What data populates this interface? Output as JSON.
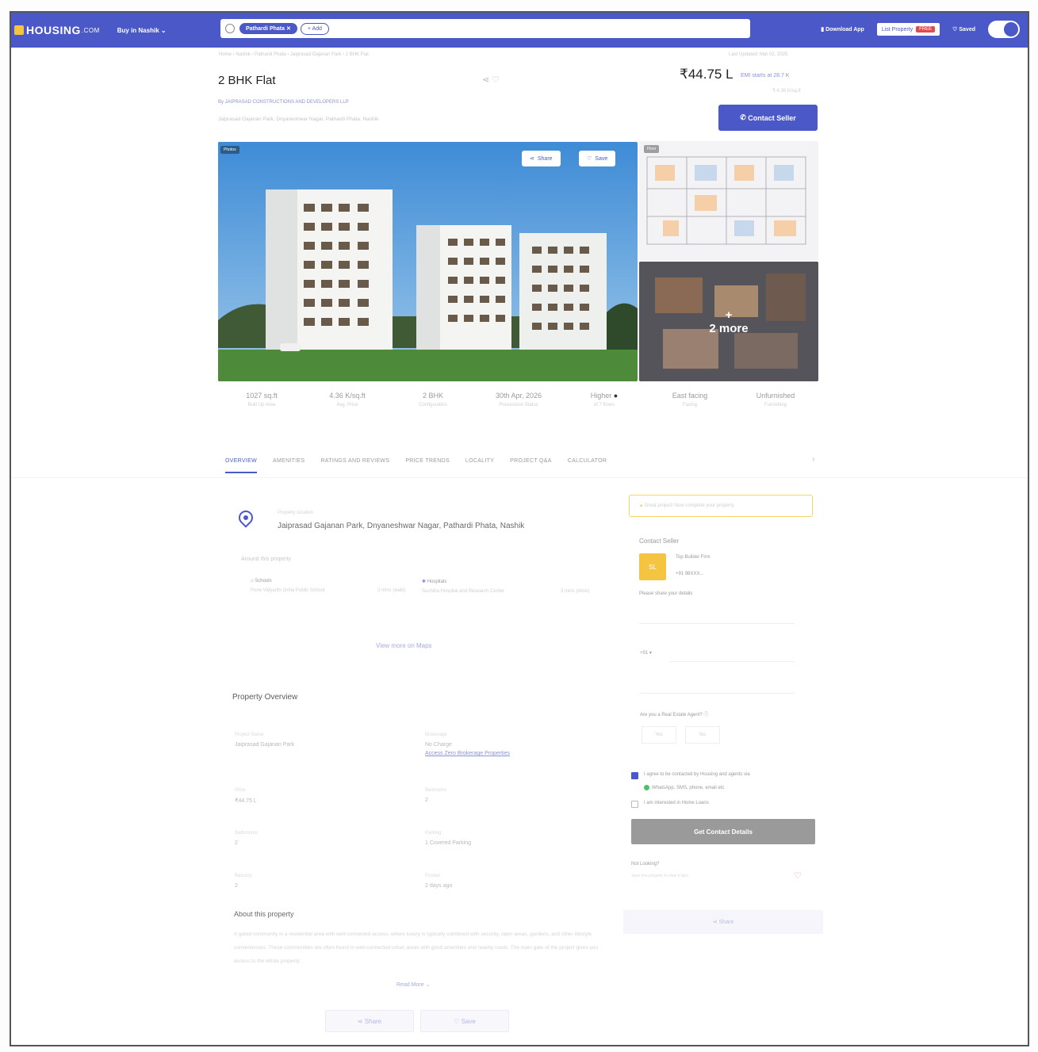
{
  "header": {
    "logo": "HOUSING",
    "logo_suffix": ".COM",
    "buy_selector": "Buy in Nashik",
    "search_chip": "Pathardi Phata",
    "search_add": "+ Add",
    "download_app": "Download App",
    "list_property": "List Property",
    "free_badge": "FREE",
    "saved": "Saved"
  },
  "breadcrumb": "Home › Nashik › Pathardi Phata › Jaiprasad Gajanan Park › 2 BHK Flat",
  "last_updated": "Last Updated: Mar 02, 2025",
  "listing": {
    "title": "2 BHK Flat",
    "builder": "By JAIPRASAD CONSTRUCTIONS AND DEVELOPERS LLP",
    "address": "Jaiprasad Gajanan Park, Dnyaneshwar Nagar, Pathardi Phata, Nashik",
    "price": "₹44.75 L",
    "emi": "EMI starts at 28.7 K",
    "per_sqft": "₹ 4.36 K/sq.ft",
    "contact_button": "Contact Seller"
  },
  "gallery": {
    "photos_tag": "Photos",
    "share_label": "Share",
    "save_label": "Save",
    "floor_tag": "Floor",
    "more_label": "2 more",
    "more_plus": "+"
  },
  "specs": [
    {
      "value": "1027 sq.ft",
      "label": "Built Up Area"
    },
    {
      "value": "4.36 K/sq.ft",
      "label": "Avg. Price"
    },
    {
      "value": "2 BHK",
      "label": "Configuration"
    },
    {
      "value": "30th Apr, 2026",
      "label": "Possession Status"
    },
    {
      "value": "Higher",
      "label": "of 7 floors"
    },
    {
      "value": "East facing",
      "label": "Facing"
    },
    {
      "value": "Unfurnished",
      "label": "Furnishing"
    }
  ],
  "tabs": [
    "OVERVIEW",
    "AMENITIES",
    "RATINGS AND REVIEWS",
    "PRICE TRENDS",
    "LOCALITY",
    "PROJECT Q&A",
    "CALCULATOR"
  ],
  "location": {
    "small": "Property location",
    "text": "Jaiprasad Gajanan Park, Dnyaneshwar Nagar, Pathardi Phata, Nashik",
    "around": "Around this property",
    "nearby": [
      {
        "type": "Schools",
        "name": "Pune Vidyarthi Griha Public School",
        "dist": "2 mins (walk)"
      },
      {
        "type": "Hospitals",
        "name": "Suchitra Hospital and Research Center",
        "dist": "3 mins (drive)"
      }
    ],
    "view_maps": "View more on Maps"
  },
  "overview": {
    "title": "Property Overview",
    "items": [
      {
        "key": "Project Name",
        "value": "Jaiprasad Gajanan Park"
      },
      {
        "key": "Brokerage",
        "value": "No Charge"
      },
      {
        "key": "Price",
        "value": "₹44.75 L"
      },
      {
        "key": "Bedrooms",
        "value": "2"
      },
      {
        "key": "Bathrooms",
        "value": "2"
      },
      {
        "key": "Parking",
        "value": "1 Covered Parking"
      },
      {
        "key": "Balcony",
        "value": "2"
      },
      {
        "key": "Posted",
        "value": "2 days ago"
      }
    ],
    "zero_brokerage": "Access Zero Brokerage Properties",
    "about_title": "About this property",
    "about_text": "A gated community in a residential area with well-connected access, where luxury is typically combined with security, open areas, gardens, and other lifestyle conveniences. These communities are often found in well-connected urban areas with good amenities and nearby roads. The main gate of the project gives you access to the whole property.",
    "read_more": "Read More",
    "share": "Share",
    "save": "Save"
  },
  "sidebar": {
    "tip": "Great project! Now complete your property",
    "contact_heading": "Contact Seller",
    "seller_initials": "SL",
    "seller_name": "Top Builder Firm",
    "seller_phone": "+91 98XXX...",
    "share_details": "Please share your details",
    "country_code": "+91",
    "agent_question": "Are you a Real Estate Agent?",
    "yes": "Yes",
    "no": "No",
    "agree_text": "I agree to be contacted by Housing and agents via",
    "channels": "WhatsApp, SMS, phone, email etc",
    "loan_text": "I am interested in Home Loans",
    "get_contact": "Get Contact Details",
    "not_looking": "Not Looking?",
    "not_looking_sub": "Save this property to view it later",
    "share_button": "Share"
  },
  "colors": {
    "brand": "#4a58c8",
    "accent_yellow": "#f5c542",
    "whatsapp": "#4bc26a"
  }
}
